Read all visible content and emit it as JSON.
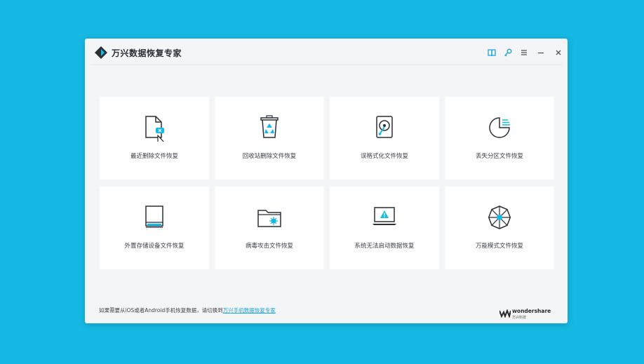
{
  "app": {
    "title": "万兴数据恢复专家",
    "accent": "#15b9e3",
    "icons": [
      "book-icon",
      "key-icon",
      "menu-icon",
      "minimize-icon",
      "close-icon"
    ]
  },
  "cards": [
    {
      "label": "最近删除文件恢复",
      "icon": "recent-deleted-file-icon"
    },
    {
      "label": "回收站删除文件恢复",
      "icon": "recycle-bin-icon"
    },
    {
      "label": "误格式化文件恢复",
      "icon": "formatted-drive-icon"
    },
    {
      "label": "丢失分区文件恢复",
      "icon": "lost-partition-icon"
    },
    {
      "label": "外置存储设备文件恢复",
      "icon": "external-storage-icon"
    },
    {
      "label": "病毒攻击文件恢复",
      "icon": "virus-attack-icon"
    },
    {
      "label": "系统无法启动数据恢复",
      "icon": "system-crash-icon"
    },
    {
      "label": "万能模式文件恢复",
      "icon": "all-around-mode-icon"
    }
  ],
  "footer": {
    "text": "如果需要从iOS或者Android手机恢复数据，请切换到",
    "link": "万兴手机数据恢复专家"
  },
  "brand": {
    "name": "wondershare",
    "sub": "万兴科技"
  }
}
